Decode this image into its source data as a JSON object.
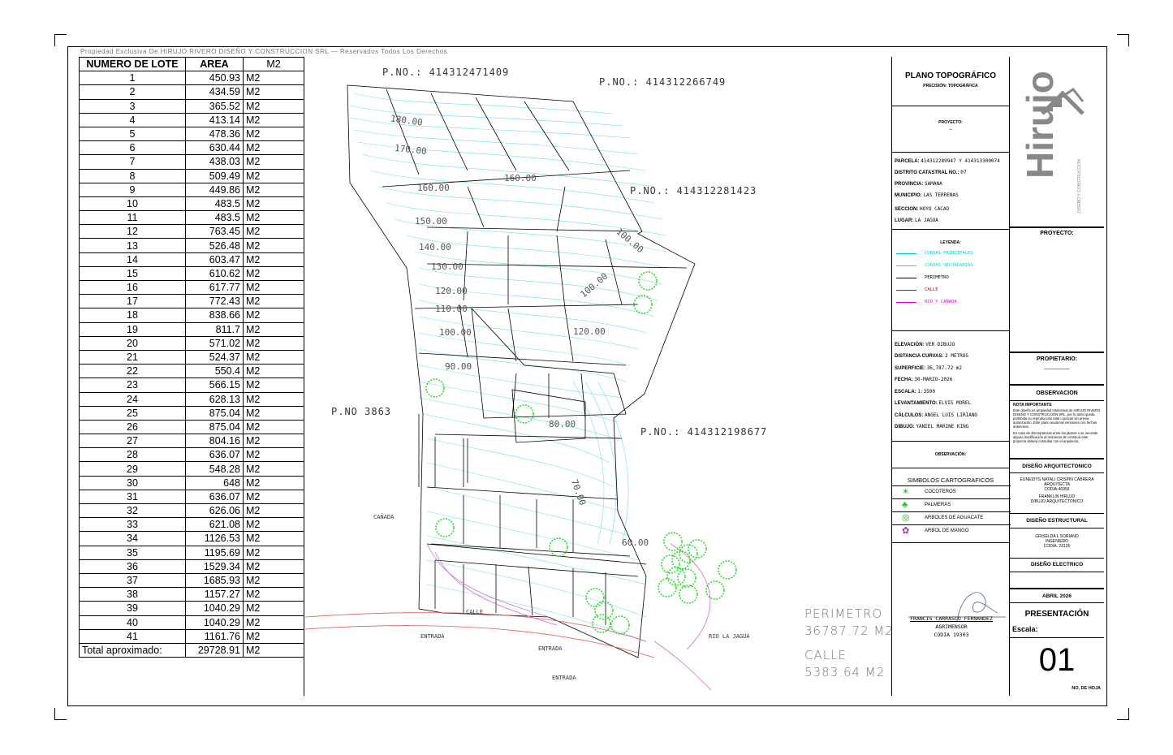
{
  "copyright": "Propiedad Exclusiva De HIRUJO RIVERO DISEÑO Y CONSTRUCCION SRL — Reservados Todos Los Derechos",
  "lot_table": {
    "headers": [
      "NUMERO DE LOTE",
      "AREA",
      "M2"
    ],
    "rows": [
      [
        "1",
        "450.93",
        "M2"
      ],
      [
        "2",
        "434.59",
        "M2"
      ],
      [
        "3",
        "365.52",
        "M2"
      ],
      [
        "4",
        "413.14",
        "M2"
      ],
      [
        "5",
        "478.36",
        "M2"
      ],
      [
        "6",
        "630.44",
        "M2"
      ],
      [
        "7",
        "438.03",
        "M2"
      ],
      [
        "8",
        "509.49",
        "M2"
      ],
      [
        "9",
        "449.86",
        "M2"
      ],
      [
        "10",
        "483.5",
        "M2"
      ],
      [
        "11",
        "483.5",
        "M2"
      ],
      [
        "12",
        "763.45",
        "M2"
      ],
      [
        "13",
        "526.48",
        "M2"
      ],
      [
        "14",
        "603.47",
        "M2"
      ],
      [
        "15",
        "610.62",
        "M2"
      ],
      [
        "16",
        "617.77",
        "M2"
      ],
      [
        "17",
        "772.43",
        "M2"
      ],
      [
        "18",
        "838.66",
        "M2"
      ],
      [
        "19",
        "811.7",
        "M2"
      ],
      [
        "20",
        "571.02",
        "M2"
      ],
      [
        "21",
        "524.37",
        "M2"
      ],
      [
        "22",
        "550.4",
        "M2"
      ],
      [
        "23",
        "566.15",
        "M2"
      ],
      [
        "24",
        "628.13",
        "M2"
      ],
      [
        "25",
        "875.04",
        "M2"
      ],
      [
        "26",
        "875.04",
        "M2"
      ],
      [
        "27",
        "804.16",
        "M2"
      ],
      [
        "28",
        "636.07",
        "M2"
      ],
      [
        "29",
        "548.28",
        "M2"
      ],
      [
        "30",
        "648",
        "M2"
      ],
      [
        "31",
        "636.07",
        "M2"
      ],
      [
        "32",
        "626.06",
        "M2"
      ],
      [
        "33",
        "621.08",
        "M2"
      ],
      [
        "34",
        "1126.53",
        "M2"
      ],
      [
        "35",
        "1195.69",
        "M2"
      ],
      [
        "36",
        "1529.34",
        "M2"
      ],
      [
        "37",
        "1685.93",
        "M2"
      ],
      [
        "38",
        "1157.27",
        "M2"
      ],
      [
        "39",
        "1040.29",
        "M2"
      ],
      [
        "40",
        "1040.29",
        "M2"
      ],
      [
        "41",
        "1161.76",
        "M2"
      ]
    ],
    "total": [
      "Total aproximado:",
      "29728.91",
      "M2"
    ]
  },
  "map": {
    "pno_labels": [
      "P.NO.: 414312471409",
      "P.NO.: 414312266749",
      "P.NO.: 414312281423",
      "P.NO 3863",
      "P.NO.: 414312198677"
    ],
    "contours": [
      "180.00",
      "170.00",
      "160.00",
      "160.00",
      "150.00",
      "140.00",
      "130.00",
      "120.00",
      "110.00",
      "100.00",
      "90.00",
      "120.00",
      "80.00",
      "70.00",
      "60.00",
      "100.00",
      "100.00"
    ],
    "labels": {
      "canada": "CAÑADA",
      "calle": "CALLE",
      "entrada1": "ENTRADA",
      "entrada2": "ENTRADA",
      "entrada3": "ENTRADA",
      "rio": "RIO LA JAGUA"
    },
    "perimetro_label": "PERIMETRO",
    "perimetro_value": "36787.72 M2",
    "calle_label": "CALLE",
    "calle_value": "5383.64 M2",
    "surveyor_name": "FRANCIS CARRASCO FERNANDEZ",
    "surveyor_role": "AGRIMENSOR",
    "surveyor_codia": "CODIA 19303"
  },
  "title_block": {
    "plan_title": "PLANO TOPOGRÁFICO",
    "precision": "PRECISIÓN: TOPOGRÁFICA",
    "proyecto_label": "PROYECTO:",
    "proyecto_value": "--",
    "parcela_label": "PARCELA:",
    "parcela_value": "414312289947 Y 414313300074",
    "distrito_label": "DISTRITO CATASTRAL NO.:",
    "distrito_value": "07",
    "provincia_label": "PROVINCIA:",
    "provincia_value": "SAMANA",
    "municipio_label": "MUNICIPIO:",
    "municipio_value": "LAS TERRENAS",
    "seccion_label": "SECCION:",
    "seccion_value": "HOYO CACAO",
    "lugar_label": "LUGAR:",
    "lugar_value": "LA JAGUA",
    "leyenda_title": "LEYENDA:",
    "leyenda": [
      {
        "text": "CURVAS PRINCIPALES",
        "color": "#00c8e0"
      },
      {
        "text": "CURVAS SECUNDARIAS",
        "color": "#00e0e0"
      },
      {
        "text": "PERIMETRO",
        "color": "#000000"
      },
      {
        "text": "CALLE",
        "color": "#e00000"
      },
      {
        "text": "RIO Y CAÑADA",
        "color": "#e000e0"
      }
    ],
    "elevacion_label": "ELEVACIÓN:",
    "elevacion_value": "VER DIBUJO",
    "distancia_label": "DISTANCIA CURVAS:",
    "distancia_value": "2 METROS",
    "superficie_label": "SUPERFICIE:",
    "superficie_value": "36,787.72 m2",
    "fecha_label": "FECHA:",
    "fecha_value": "30-MARZO-2026",
    "escala_label": "ESCALA:",
    "escala_value": "1:3500",
    "levantamiento_label": "LEVANTAMIENTO:",
    "levantamiento_value": "ELVIS MOREL",
    "calculo_label": "CÁLCULOS:",
    "calculo_value": "ANGEL LUIS LIRIANO",
    "dibujo_label": "DIBUJO:",
    "dibujo_value": "YANIEL MARINE KING",
    "observacion_label": "OBSERVACIÓN:",
    "simbolos_title": "SIMBOLOS CARTOGRAFICOS",
    "simbolos": [
      {
        "text": "COCOTEROS",
        "icon": "star",
        "color": "#22cc22"
      },
      {
        "text": "PALMERAS",
        "icon": "palm",
        "color": "#22cc22"
      },
      {
        "text": "ARBOLES DE AGUACATE",
        "icon": "circle",
        "color": "#22cc22"
      },
      {
        "text": "ARBOL DE MANGO",
        "icon": "flower",
        "color": "#aa22cc"
      }
    ]
  },
  "right_block": {
    "logo_text": "Hirujo",
    "logo_sub": "DISEÑO Y CONSTRUCCION",
    "proyecto_label": "PROYECTO:",
    "propietario_label": "PROPIETARIO:",
    "propietario_value": "________",
    "observacion_label": "OBSERVACION",
    "nota_title": "NOTA IMPORTANTE",
    "nota_1": "Este diseño es propiedad Intelectual de HIRUJO RIVERO DISEÑO Y CONSTRUCCIÓN SRL, por lo tanto queda prohibida su reproducción total o parcial sin previa autorización. Este plano anula las versiones con fechas anteriores.",
    "nota_2": "En caso de discrepancias entre los planos o se necesite alguna modificación al momento de construir este proyecto deberá consultar con el arquitecto.",
    "arq_title": "DISEÑO ARQUITECTONICO",
    "arq_1": "EUNEIDYS NATALI CRISPIN CABRERA",
    "arq_2": "ARQUITECTA",
    "arq_3": "CODIA:46956",
    "arq_4": "FRANKLIN HIRUJO",
    "arq_5": "DIBUJO ARQUITECTONICO",
    "est_title": "DISEÑO ESTRUCTURAL",
    "est_1": "GRISELDA L SORIANO",
    "est_2": "INGENIERO",
    "est_3": "CODIA. 23126",
    "elec_title": "DISEÑO ELECTRICO",
    "fecha": "ABRIL 2026",
    "presentacion": "PRESENTACIÓN",
    "escala_label": "Escala:",
    "hoja_number": "01",
    "hoja_label": "NO. DE HOJA"
  }
}
